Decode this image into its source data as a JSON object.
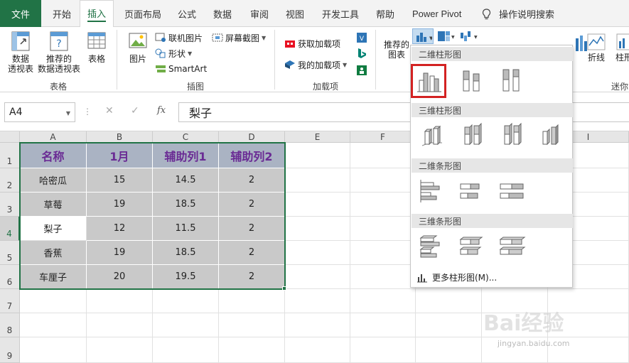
{
  "tabs": [
    "文件",
    "开始",
    "插入",
    "页面布局",
    "公式",
    "数据",
    "审阅",
    "视图",
    "开发工具",
    "帮助",
    "Power Pivot",
    "操作说明搜索"
  ],
  "ribbon": {
    "pivot_l1": "数据",
    "pivot_l2": "透视表",
    "recpivot_l1": "推荐的",
    "recpivot_l2": "数据透视表",
    "table": "表格",
    "group_table": "表格",
    "picture": "图片",
    "online_picture": "联机图片",
    "shapes": "形状",
    "smartart": "SmartArt",
    "screenshot": "屏幕截图",
    "group_illustrations": "插图",
    "get_addins": "获取加载项",
    "my_addins": "我的加载项",
    "group_addins": "加载项",
    "recchart_l1": "推荐的",
    "recchart_l2": "图表",
    "line": "折线",
    "column_partial": "柱形",
    "sparklines_partial": "迷你"
  },
  "formula_bar": {
    "name_box": "A4",
    "fx": "fx",
    "value": "梨子"
  },
  "columns": [
    "A",
    "B",
    "C",
    "D",
    "E",
    "F",
    "G",
    "H",
    "I"
  ],
  "rows": [
    "1",
    "2",
    "3",
    "4",
    "5",
    "6",
    "7",
    "8",
    "9"
  ],
  "table": {
    "headers": [
      "名称",
      "1月",
      "辅助列1",
      "辅助列2"
    ],
    "rows": [
      [
        "哈密瓜",
        "15",
        "14.5",
        "2"
      ],
      [
        "草莓",
        "19",
        "18.5",
        "2"
      ],
      [
        "梨子",
        "12",
        "11.5",
        "2"
      ],
      [
        "香蕉",
        "19",
        "18.5",
        "2"
      ],
      [
        "车厘子",
        "20",
        "19.5",
        "2"
      ]
    ]
  },
  "dropdown": {
    "sec1": "二维柱形图",
    "sec2": "三维柱形图",
    "sec3": "二维条形图",
    "sec4": "三维条形图",
    "more": "更多柱形图(M)..."
  },
  "watermark": {
    "brand": "Bai经验",
    "url": "jingyan.baidu.com"
  },
  "colors": {
    "excel_green": "#217346",
    "header_fill": "#aab3c3",
    "header_text": "#6a2b94",
    "body_fill": "#c9c9c9",
    "highlight_red": "#d32222"
  }
}
